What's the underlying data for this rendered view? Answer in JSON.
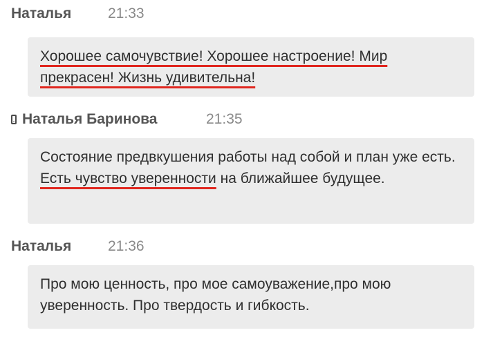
{
  "messages": [
    {
      "author": "Наталья",
      "time": "21:33",
      "has_phone_icon": false,
      "text_parts": [
        {
          "text": "Хорошее самочувствие! Хорошее настроение! Мир прекрасен! Жизнь удивительна!",
          "highlighted": true
        }
      ]
    },
    {
      "author": "Наталья Баринова",
      "time": "21:35",
      "has_phone_icon": true,
      "icon": "mobile-phone-icon",
      "text_parts": [
        {
          "text": "Состояние предвкушения работы над собой и план уже есть. ",
          "highlighted": false
        },
        {
          "text": "Есть чувство уверенности",
          "highlighted": true
        },
        {
          "text": " на ближайшее будущее.",
          "highlighted": false
        }
      ]
    },
    {
      "author": "Наталья",
      "time": "21:36",
      "has_phone_icon": false,
      "text_parts": [
        {
          "text": "Про мою ценность, про мое самоуважение,про мою уверенность. Про твердость и гибкость.",
          "highlighted": false
        }
      ]
    }
  ],
  "colors": {
    "bubble_background": "#ececec",
    "highlight_underline": "#e0261e",
    "author_text": "#555555",
    "time_text": "#8a8a8a"
  }
}
